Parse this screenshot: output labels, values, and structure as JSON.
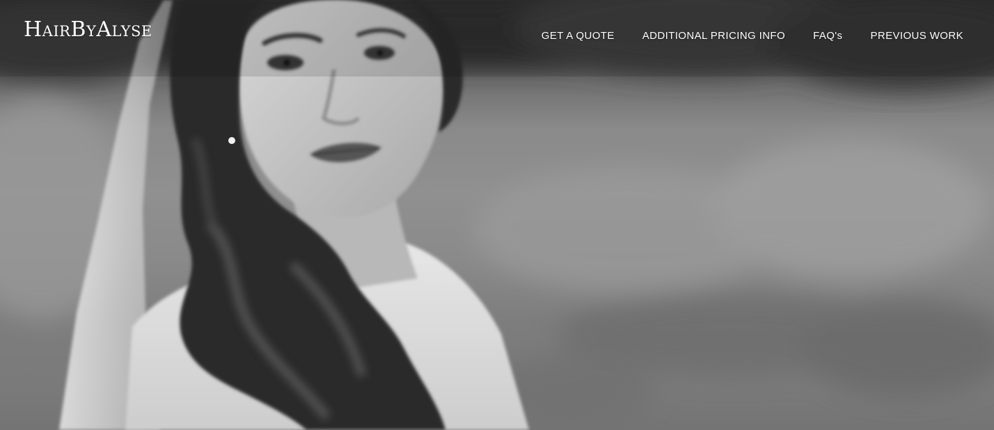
{
  "site": {
    "logo_text": "HairByAlyse"
  },
  "nav": {
    "items": [
      {
        "label": "GET A QUOTE"
      },
      {
        "label": "ADDITIONAL PRICING INFO"
      },
      {
        "label": "FAQ's"
      },
      {
        "label": "PREVIOUS WORK"
      }
    ]
  },
  "hero": {
    "image_subject": "bride-portrait-photo",
    "color_mode": "black-and-white"
  },
  "colors": {
    "nav_text": "#ffffff",
    "logo_text": "#ffffff"
  }
}
